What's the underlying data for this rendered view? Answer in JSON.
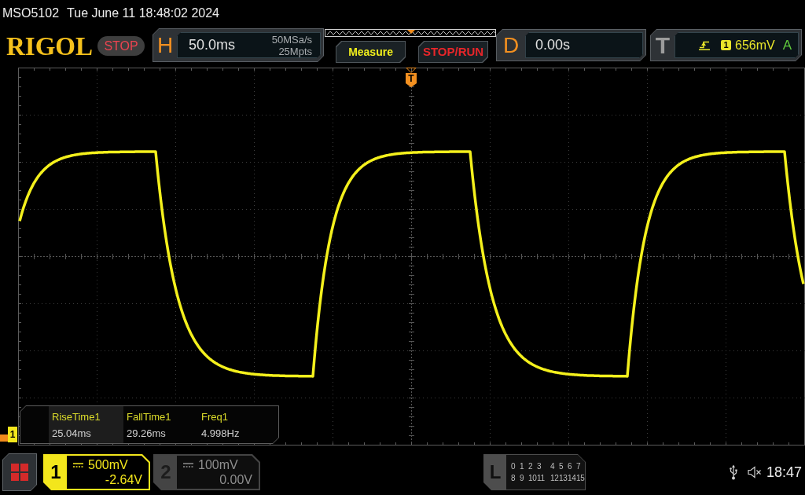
{
  "status_line": {
    "model": "MSO5102",
    "datetime": "Tue June 11 18:48:02 2024"
  },
  "toolbar": {
    "logo": "RIGOL",
    "run_state": "STOP"
  },
  "horizontal": {
    "label": "H",
    "timebase": "50.0ms",
    "sample_rate": "50MSa/s",
    "memory_depth": "25Mpts"
  },
  "buttons": [
    {
      "kind": "measure",
      "label": "Measure"
    },
    {
      "kind": "stop_run",
      "label": "STOP/RUN"
    }
  ],
  "delay": {
    "label": "D",
    "value": "0.00s"
  },
  "trigger": {
    "label": "T",
    "source": "1",
    "threshold": "656mV",
    "mode": "A"
  },
  "trigger_marker": {
    "label": "T"
  },
  "measurements": [
    {
      "name": "RiseTime1",
      "value": "25.04ms",
      "selected": true
    },
    {
      "name": "FallTime1",
      "value": "29.26ms",
      "selected": false
    },
    {
      "name": "Freq1",
      "value": "4.998Hz",
      "selected": false
    }
  ],
  "channel_marker": {
    "label": "1"
  },
  "channels": [
    {
      "number": "1",
      "scale": "500mV",
      "offset": "-2.64V",
      "on": true
    },
    {
      "number": "2",
      "scale": "100mV",
      "offset": "0.00V",
      "on": false
    }
  ],
  "logic": {
    "label": "L",
    "rows": [
      [
        "0",
        "1",
        "2",
        "3",
        "4",
        "5",
        "6",
        "7"
      ],
      [
        "8",
        "9",
        "10",
        "11",
        "12",
        "13",
        "14",
        "15"
      ]
    ]
  },
  "status_bar": {
    "time": "18:47"
  }
}
